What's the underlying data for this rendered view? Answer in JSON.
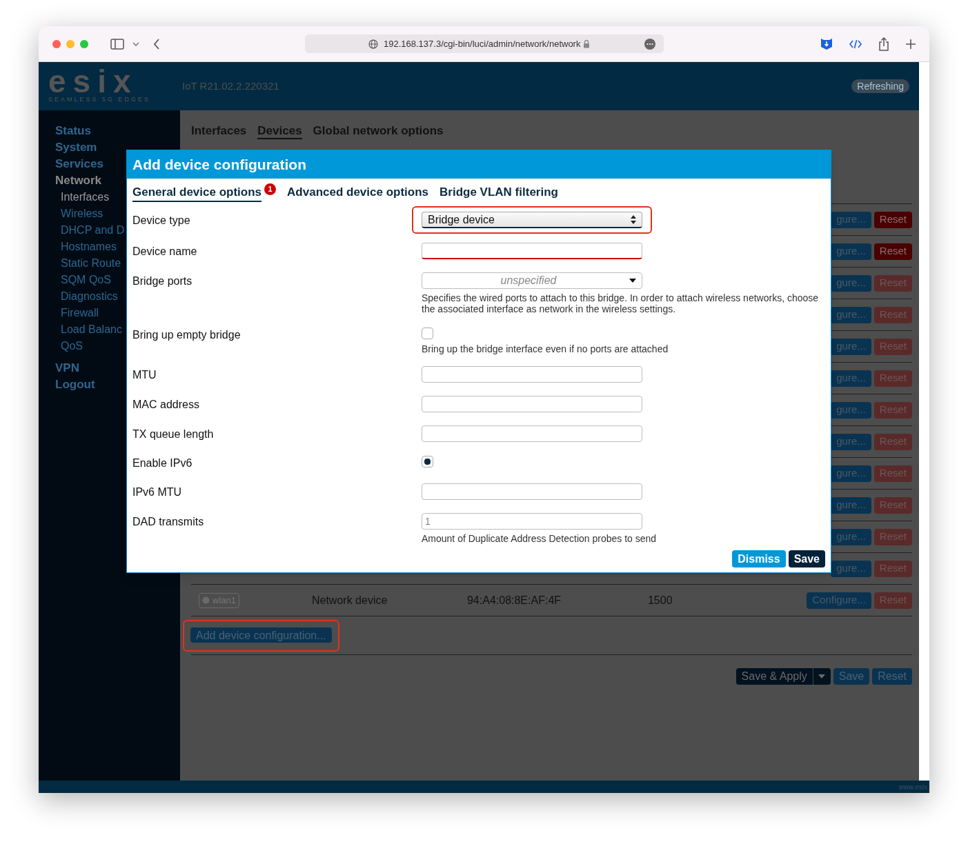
{
  "browser": {
    "url": "192.168.137.3/cgi-bin/luci/admin/network/network"
  },
  "header": {
    "logo_text": "esix",
    "logo_tagline": "SEAMLESS 5G EDGES",
    "version": "IoT R21.02.2.220321",
    "status_badge": "Refreshing"
  },
  "sidebar": {
    "items": [
      {
        "label": "Status",
        "selected": false
      },
      {
        "label": "System",
        "selected": false
      },
      {
        "label": "Services",
        "selected": false
      },
      {
        "label": "Network",
        "selected": true,
        "children": [
          {
            "label": "Interfaces",
            "selected": true
          },
          {
            "label": "Wireless",
            "selected": false
          },
          {
            "label": "DHCP and D",
            "selected": false
          },
          {
            "label": "Hostnames",
            "selected": false
          },
          {
            "label": "Static Route",
            "selected": false
          },
          {
            "label": "SQM QoS",
            "selected": false
          },
          {
            "label": "Diagnostics",
            "selected": false
          },
          {
            "label": "Firewall",
            "selected": false
          },
          {
            "label": "Load Balanc",
            "selected": false
          },
          {
            "label": "QoS",
            "selected": false
          }
        ]
      },
      {
        "label": "VPN",
        "selected": false
      },
      {
        "label": "Logout",
        "selected": false
      }
    ]
  },
  "tabs": [
    {
      "label": "Interfaces",
      "selected": false
    },
    {
      "label": "Devices",
      "selected": true
    },
    {
      "label": "Global network options",
      "selected": false
    }
  ],
  "device_rows_hidden": [
    {
      "configure": "gure...",
      "reset": "Reset",
      "disabled": false
    },
    {
      "configure": "gure...",
      "reset": "Reset",
      "disabled": false
    },
    {
      "configure": "gure...",
      "reset": "Reset",
      "disabled": true
    },
    {
      "configure": "gure...",
      "reset": "Reset",
      "disabled": true
    },
    {
      "configure": "gure...",
      "reset": "Reset",
      "disabled": true
    },
    {
      "configure": "gure...",
      "reset": "Reset",
      "disabled": true
    },
    {
      "configure": "gure...",
      "reset": "Reset",
      "disabled": true
    },
    {
      "configure": "gure...",
      "reset": "Reset",
      "disabled": true
    },
    {
      "configure": "gure...",
      "reset": "Reset",
      "disabled": true
    },
    {
      "configure": "gure...",
      "reset": "Reset",
      "disabled": true
    },
    {
      "configure": "gure...",
      "reset": "Reset",
      "disabled": true
    },
    {
      "configure": "gure...",
      "reset": "Reset",
      "disabled": true
    }
  ],
  "device_row": {
    "device": "wlan1",
    "type": "Network device",
    "mac": "94:A4:08:8E:AF:4F",
    "mtu": "1500",
    "configure": "Configure...",
    "reset": "Reset",
    "disabled": true
  },
  "add_button": {
    "label": "Add device configuration...",
    "highlighted": true
  },
  "footer_actions": {
    "save_apply": "Save & Apply",
    "save": "Save",
    "reset": "Reset"
  },
  "footer": {
    "text": "www.esix."
  },
  "modal": {
    "title": "Add device configuration",
    "tabs": [
      {
        "label": "General device options",
        "selected": true,
        "badge": "1"
      },
      {
        "label": "Advanced device options",
        "selected": false
      },
      {
        "label": "Bridge VLAN filtering",
        "selected": false
      }
    ],
    "fields": [
      {
        "kind": "select",
        "label": "Device type",
        "value": "Bridge device",
        "highlighted": true
      },
      {
        "kind": "text",
        "label": "Device name",
        "error": true
      },
      {
        "kind": "multiselect",
        "label": "Bridge ports",
        "placeholder": "unspecified",
        "help": "Specifies the wired ports to attach to this bridge. In order to attach wireless networks, choose the associated interface as network in the wireless settings."
      },
      {
        "kind": "checkbox",
        "label": "Bring up empty bridge",
        "checked": false,
        "help": "Bring up the bridge interface even if no ports are attached"
      },
      {
        "kind": "text",
        "label": "MTU",
        "error": false
      },
      {
        "kind": "text",
        "label": "MAC address",
        "error": false
      },
      {
        "kind": "text",
        "label": "TX queue length",
        "error": false
      },
      {
        "kind": "checkbox",
        "label": "Enable IPv6",
        "checked": true
      },
      {
        "kind": "text",
        "label": "IPv6 MTU",
        "error": false
      },
      {
        "kind": "text",
        "label": "DAD transmits",
        "error": false,
        "placeholder": "1",
        "help": "Amount of Duplicate Address Detection probes to send"
      }
    ],
    "buttons": {
      "dismiss": "Dismiss",
      "save": "Save"
    }
  }
}
